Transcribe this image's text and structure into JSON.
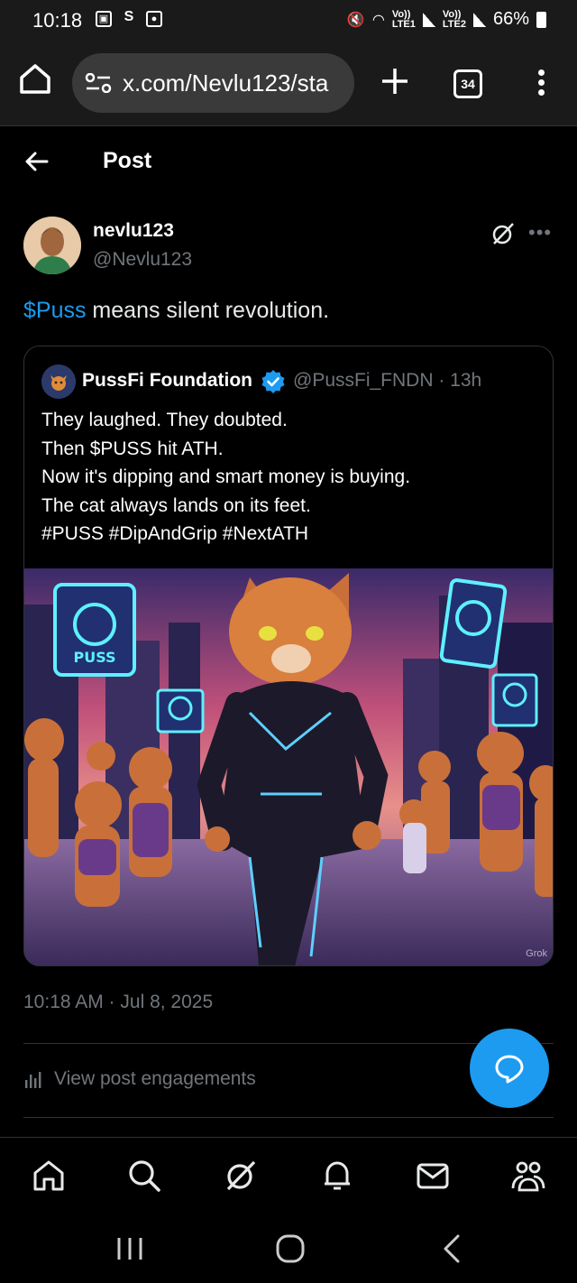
{
  "status_bar": {
    "time": "10:18",
    "net1": "Vo))\nLTE1",
    "net2": "Vo))\nLTE2",
    "battery": "66%"
  },
  "browser": {
    "url": "x.com/Nevlu123/sta",
    "tab_count": "34"
  },
  "header": {
    "title": "Post"
  },
  "post": {
    "author_name": "nevlu123",
    "author_handle": "@Nevlu123",
    "text_cashtag": "$Puss",
    "text_rest": " means silent revolution.",
    "timestamp": "10:18 AM · Jul 8, 2025",
    "engagements_label": "View post engagements"
  },
  "quote": {
    "name": "PussFi Foundation",
    "handle_time": "@PussFi_FNDN · 13h",
    "lines": [
      "They laughed. They doubted.",
      "Then $PUSS hit ATH.",
      "Now it's dipping and smart money is buying.",
      "The cat always lands on its feet.",
      "#PUSS #DipAndGrip #NextATH"
    ],
    "image_watermark": "Grok",
    "sign_text": "PUSS"
  },
  "colors": {
    "accent": "#1d9bf0",
    "secondary_text": "#71767b",
    "background": "#000000",
    "divider": "#2f3336"
  },
  "icons": {
    "tabbar": [
      "home-icon",
      "search-icon",
      "grok-icon",
      "notifications-icon",
      "messages-icon",
      "communities-icon"
    ],
    "sysnav": [
      "recents-icon",
      "home-circle-icon",
      "back-chevron-icon"
    ]
  }
}
